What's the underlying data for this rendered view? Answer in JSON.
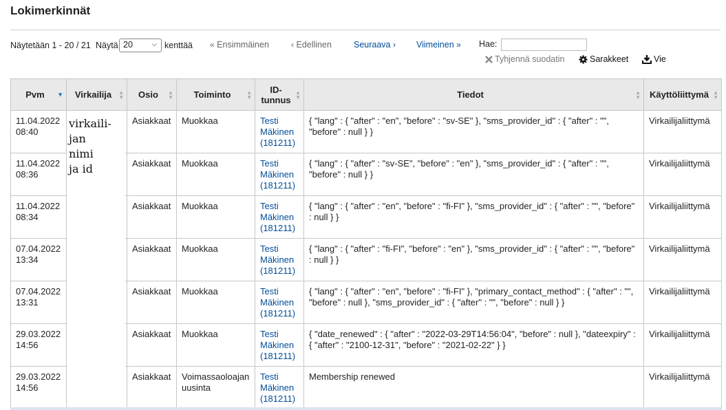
{
  "title": "Lokimerkinnät",
  "pager": {
    "info": "Näytetään 1 - 20 / 21",
    "show_label": "Näytä",
    "page_size": "20",
    "show_suffix": "kenttää",
    "first": "Ensimmäinen",
    "prev": "Edellinen",
    "next": "Seuraava",
    "last": "Viimeinen",
    "first_arrow": "«",
    "prev_arrow": "‹",
    "next_arrow": "›",
    "last_arrow": "»"
  },
  "search": {
    "label": "Hae:",
    "value": ""
  },
  "toolbar": {
    "clear_filter": "Tyhjennä suodatin",
    "columns": "Sarakkeet",
    "export": "Vie",
    "icons": {
      "clear": "x-icon",
      "columns": "gear-icon",
      "export": "download-icon"
    }
  },
  "table": {
    "headers": [
      "Pvm",
      "Virkailija",
      "Osio",
      "Toiminto",
      "ID-tunnus",
      "Tiedot",
      "Käyttöliittymä"
    ],
    "header_ids": [
      "ID-",
      "tunnus"
    ],
    "sorted_column": "Pvm",
    "rows": [
      {
        "date": "11.04.2022",
        "time": "08:40",
        "module": "Asiakkaat",
        "action": "Muokkaa",
        "patron_name": "Testi Mäkinen",
        "patron_id": "(181211)",
        "info": "{ \"lang\" : { \"after\" : \"en\", \"before\" : \"sv-SE\" }, \"sms_provider_id\" : { \"after\" : \"\", \"before\" : null } }",
        "interface": "Virkailijaliittymä"
      },
      {
        "date": "11.04.2022",
        "time": "08:36",
        "module": "Asiakkaat",
        "action": "Muokkaa",
        "patron_name": "Testi Mäkinen",
        "patron_id": "(181211)",
        "info": "{ \"lang\" : { \"after\" : \"sv-SE\", \"before\" : \"en\" }, \"sms_provider_id\" : { \"after\" : \"\", \"before\" : null } }",
        "interface": "Virkailijaliittymä"
      },
      {
        "date": "11.04.2022",
        "time": "08:34",
        "module": "Asiakkaat",
        "action": "Muokkaa",
        "patron_name": "Testi Mäkinen",
        "patron_id": "(181211)",
        "info": "{ \"lang\" : { \"after\" : \"en\", \"before\" : \"fi-FI\" }, \"sms_provider_id\" : { \"after\" : \"\", \"before\" : null } }",
        "interface": "Virkailijaliittymä"
      },
      {
        "date": "07.04.2022",
        "time": "13:34",
        "module": "Asiakkaat",
        "action": "Muokkaa",
        "patron_name": "Testi Mäkinen",
        "patron_id": "(181211)",
        "info": "{ \"lang\" : { \"after\" : \"fi-FI\", \"before\" : \"en\" }, \"sms_provider_id\" : { \"after\" : \"\", \"before\" : null } }",
        "interface": "Virkailijaliittymä"
      },
      {
        "date": "07.04.2022",
        "time": "13:31",
        "module": "Asiakkaat",
        "action": "Muokkaa",
        "patron_name": "Testi Mäkinen",
        "patron_id": "(181211)",
        "info": "{ \"lang\" : { \"after\" : \"en\", \"before\" : \"fi-FI\" }, \"primary_contact_method\" : { \"after\" : \"\", \"before\" : null }, \"sms_provider_id\" : { \"after\" : \"\", \"before\" : null } }",
        "interface": "Virkailijaliittymä"
      },
      {
        "date": "29.03.2022",
        "time": "14:56",
        "module": "Asiakkaat",
        "action": "Muokkaa",
        "patron_name": "Testi Mäkinen",
        "patron_id": "(181211)",
        "info": "{ \"date_renewed\" : { \"after\" : \"2022-03-29T14:56:04\", \"before\" : null }, \"dateexpiry\" : { \"after\" : \"2100-12-31\", \"before\" : \"2021-02-22\" } }",
        "interface": "Virkailijaliittymä"
      },
      {
        "date": "29.03.2022",
        "time": "14:56",
        "module": "Asiakkaat",
        "action": "Voimassaoloajan uusinta",
        "patron_name": "Testi Mäkinen",
        "patron_id": "(181211)",
        "info": "Membership renewed",
        "interface": "Virkailijaliittymä"
      }
    ]
  },
  "redaction": {
    "lines": [
      "virkaili-",
      "jan",
      "nimi",
      "ja id"
    ]
  }
}
